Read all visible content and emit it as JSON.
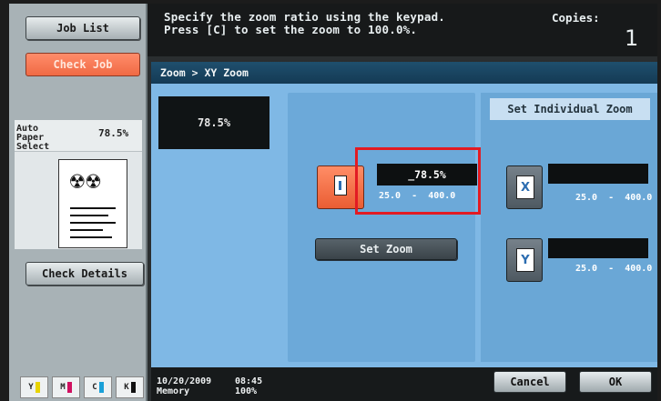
{
  "header": {
    "message_line1": "Specify the zoom ratio using the keypad.",
    "message_line2": "Press [C] to set the zoom to 100.0%.",
    "copies_label": "Copies:",
    "copies_value": "1"
  },
  "sidebar": {
    "job_list_label": "Job List",
    "check_job_label": "Check Job",
    "paper_label": "Auto Paper Select",
    "paper_zoom": "78.5%",
    "check_details_label": "Check Details",
    "toner": [
      {
        "label": "Y",
        "color": "#e8d400"
      },
      {
        "label": "M",
        "color": "#d01060"
      },
      {
        "label": "C",
        "color": "#1aa0d8"
      },
      {
        "label": "K",
        "color": "#111111"
      }
    ]
  },
  "panel": {
    "breadcrumb": "Zoom > XY Zoom",
    "current_zoom": "78.5%",
    "set_individual_zoom_label": "Set Individual Zoom",
    "ratio_value": "_78.5%",
    "range_min": "25.0",
    "range_sep": "-",
    "range_max": "400.0",
    "set_zoom_label": "Set Zoom",
    "x_axis_label": "X",
    "y_axis_label": "Y",
    "x_range_min": "25.0",
    "x_range_sep": "-",
    "x_range_max": "400.0",
    "y_range_min": "25.0",
    "y_range_sep": "-",
    "y_range_max": "400.0"
  },
  "footer": {
    "date": "10/20/2009",
    "time": "08:45",
    "memory_label": "Memory",
    "memory_value": "100%",
    "cancel_label": "Cancel",
    "ok_label": "OK"
  },
  "colors": {
    "accent_orange": "#f06a44",
    "panel_blue": "#7fb8e5",
    "highlight_red": "#e21b23",
    "dark_bar": "#171a1b"
  }
}
